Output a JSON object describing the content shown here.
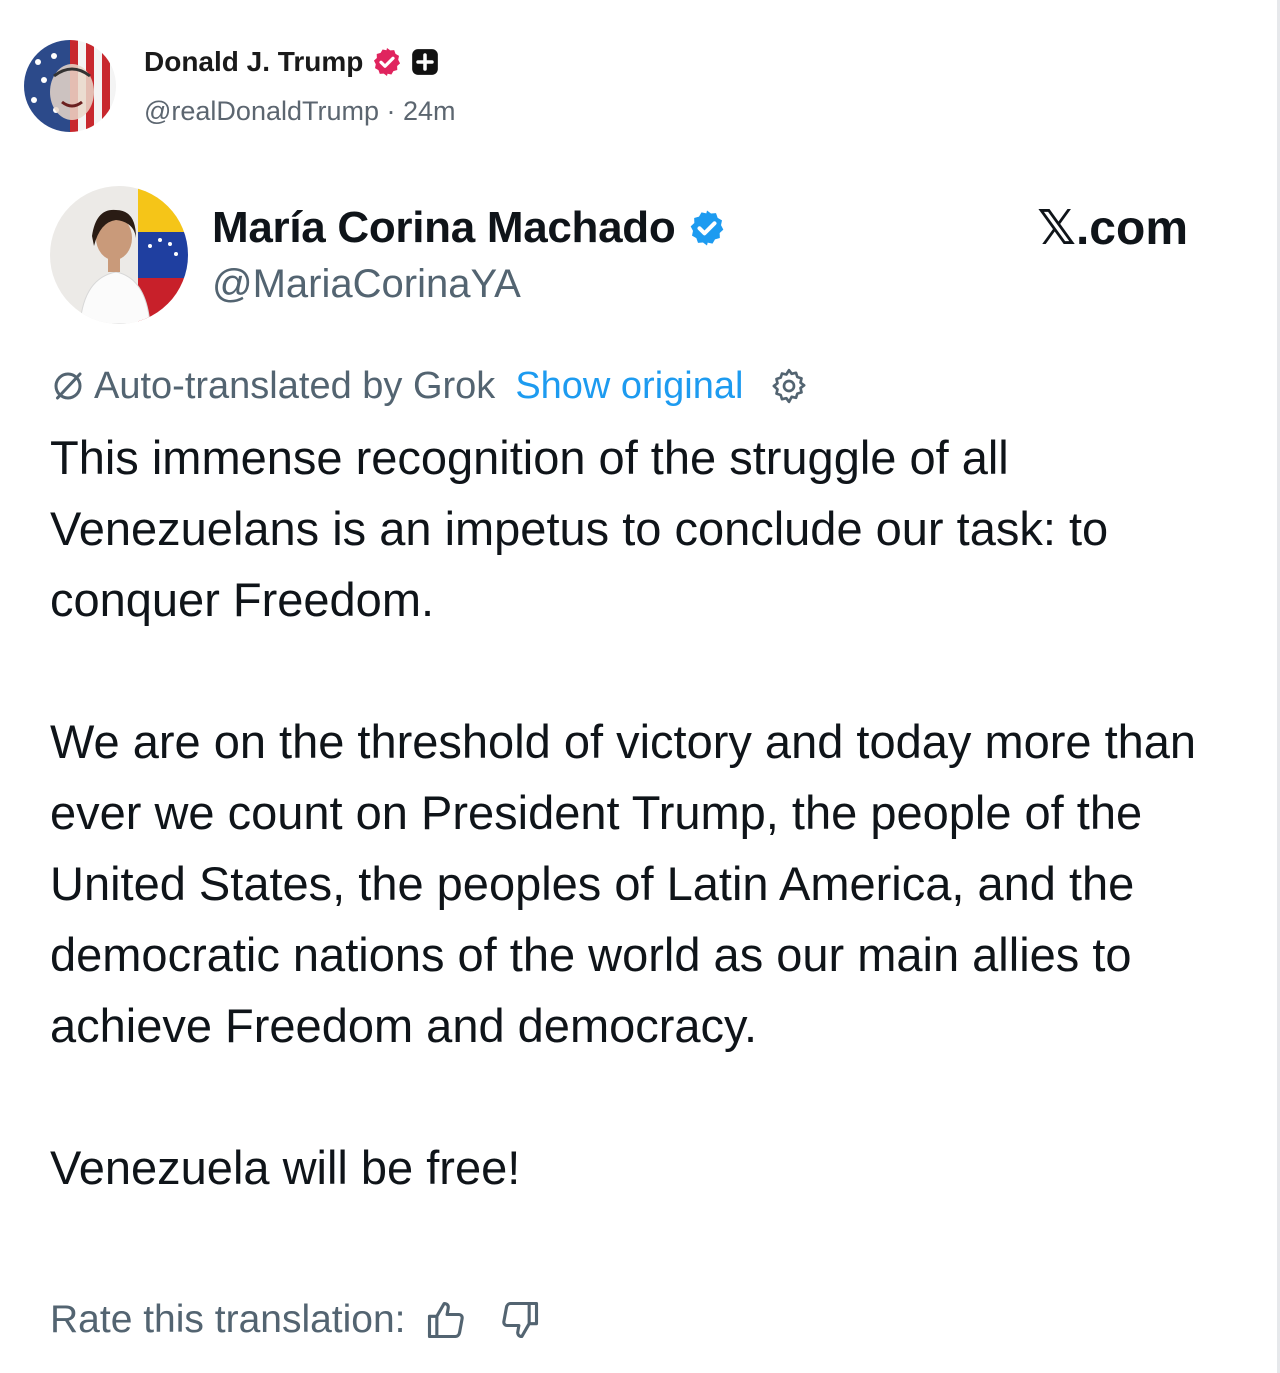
{
  "post": {
    "author_name": "Donald J. Trump",
    "handle": "@realDonaldTrump",
    "separator": " · ",
    "time": "24m"
  },
  "embed": {
    "author_name": "María Corina Machado",
    "handle": "@MariaCorinaYA",
    "source": "𝕏.com",
    "translation_label": "Auto-translated by Grok",
    "show_original": "Show original",
    "paragraphs": [
      "This immense recognition of the struggle of all Venezuelans is an impetus to conclude our task: to conquer Freedom.",
      "We are on the threshold of victory and today more than ever we count on President Trump, the people of the United States, the peoples of Latin America, and the democratic nations of the world as our main allies to achieve Freedom and democracy.",
      "Venezuela will be free!"
    ],
    "rate_label": "Rate this translation:"
  },
  "colors": {
    "text": "#0f1419",
    "secondary": "#536471",
    "link": "#1d9bf0",
    "verified_blue": "#1d9bf0",
    "verified_red": "#e0245e"
  },
  "icons": [
    "verified-badge-icon",
    "plus-badge-icon",
    "translate-icon",
    "gear-icon",
    "thumbs-up-icon",
    "thumbs-down-icon"
  ]
}
